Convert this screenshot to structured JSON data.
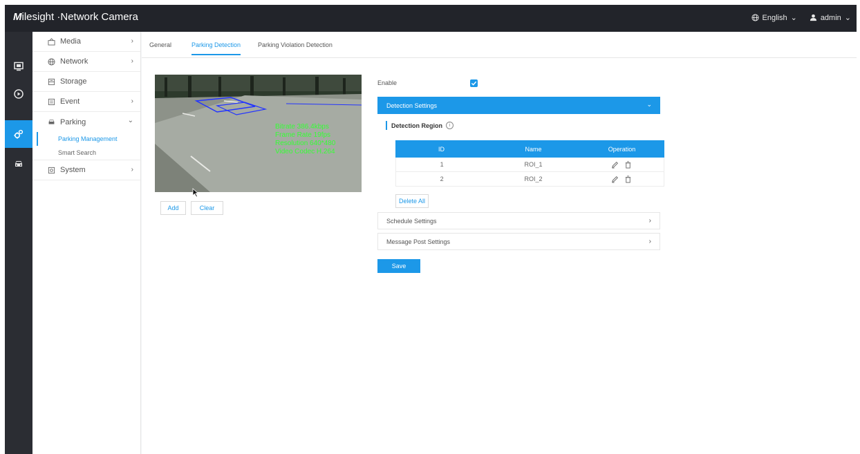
{
  "app": {
    "brand": "M",
    "brand_rest": "ilesight",
    "title": "·Network Camera"
  },
  "topbar": {
    "language": "English",
    "user": "admin"
  },
  "rail": [
    "monitor-icon",
    "playback-icon",
    "settings-icon",
    "car-icon"
  ],
  "menu": {
    "media": "Media",
    "network": "Network",
    "storage": "Storage",
    "event": "Event",
    "parking": "Parking",
    "parking_management": "Parking Management",
    "smart_search": "Smart Search",
    "system": "System"
  },
  "tabs": {
    "general": "General",
    "parking_detection": "Parking Detection",
    "parking_violation": "Parking Violation Detection"
  },
  "video_overlay": {
    "bitrate": "Bitrate 386.4kbps",
    "frame_rate": "Frame Rate 19fps",
    "resolution": "Resolution 640*480",
    "video_codec": "Video Codec H.264"
  },
  "video_buttons": {
    "add": "Add",
    "clear": "Clear"
  },
  "form": {
    "enable_label": "Enable",
    "enable_checked": true,
    "detection_settings": "Detection Settings",
    "detection_region": "Detection Region",
    "columns": [
      "ID",
      "Name",
      "Operation"
    ],
    "rows": [
      {
        "id": "1",
        "name": "ROI_1"
      },
      {
        "id": "2",
        "name": "ROI_2"
      }
    ],
    "delete_all": "Delete All",
    "schedule_settings": "Schedule Settings",
    "message_post_settings": "Message Post Settings",
    "save": "Save"
  },
  "colors": {
    "accent": "#1c98e8",
    "topbar": "#22242a",
    "rail": "#2b2d33",
    "overlay_text": "#35ff35"
  }
}
